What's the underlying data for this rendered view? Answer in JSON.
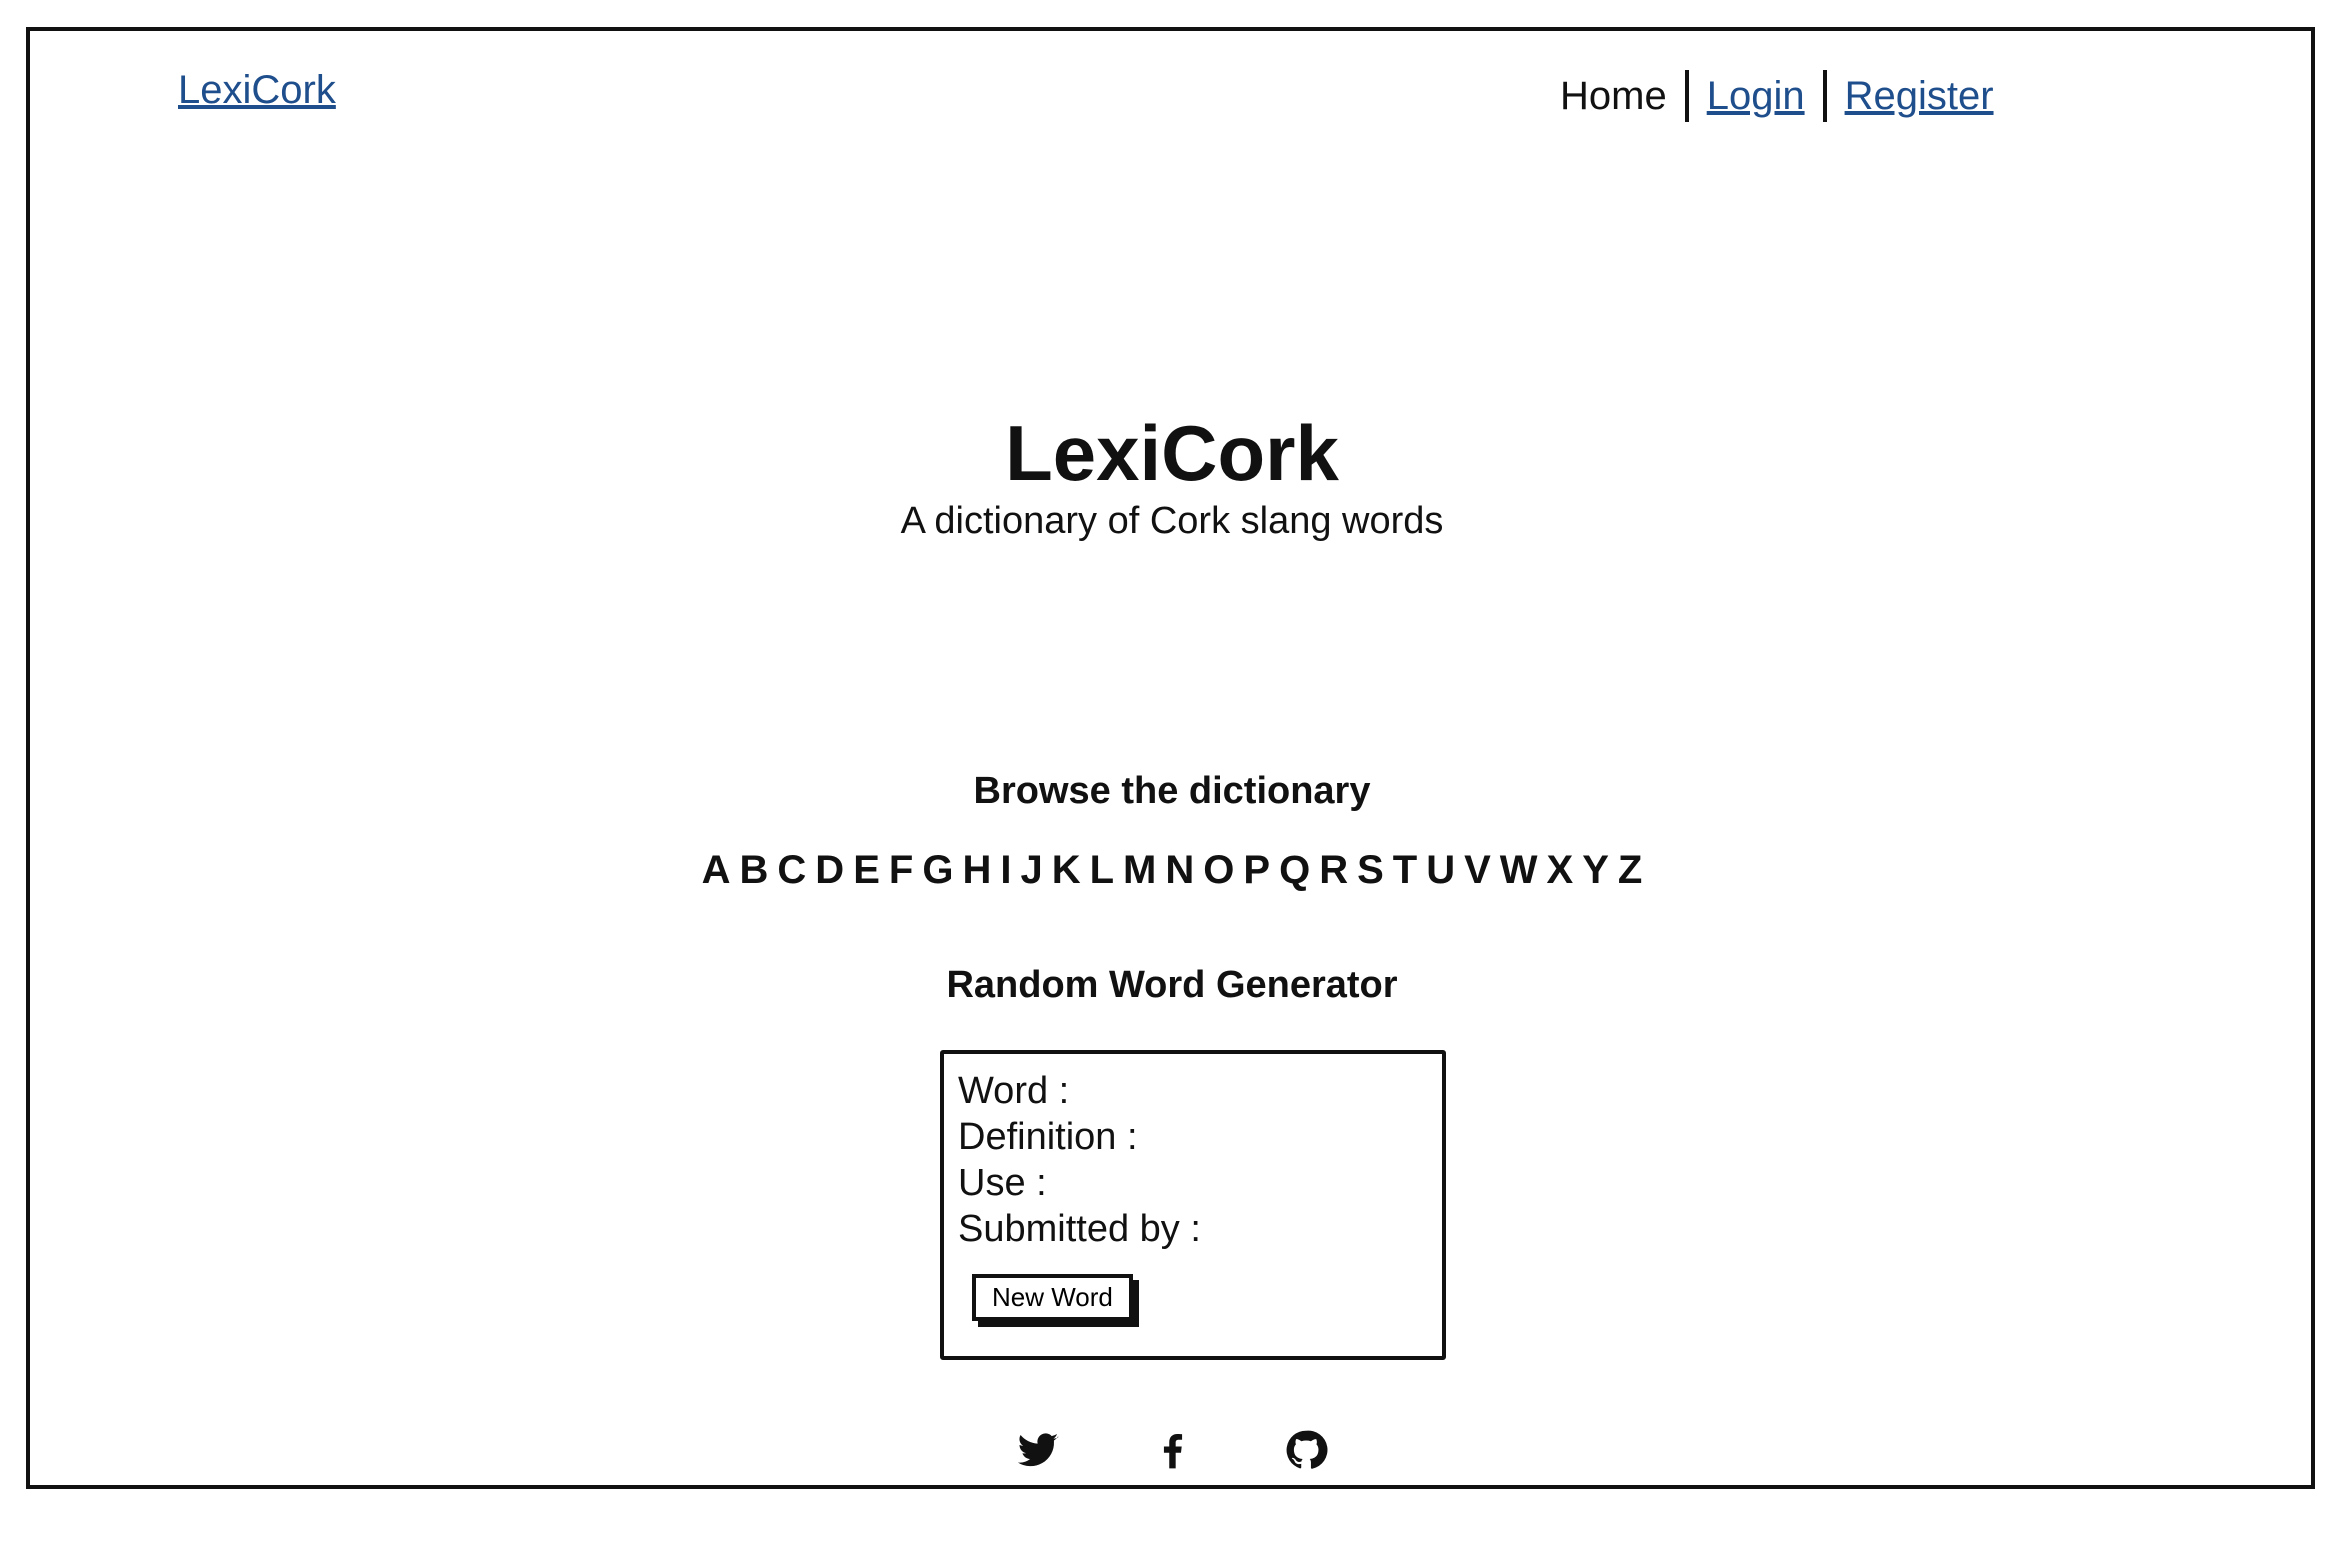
{
  "header": {
    "brand": "LexiCork",
    "nav": {
      "home": "Home",
      "login": "Login",
      "register": "Register"
    }
  },
  "hero": {
    "title": "LexiCork",
    "subtitle": "A dictionary of Cork slang words"
  },
  "browse": {
    "heading": "Browse the dictionary",
    "letters": [
      "A",
      "B",
      "C",
      "D",
      "E",
      "F",
      "G",
      "H",
      "I",
      "J",
      "K",
      "L",
      "M",
      "N",
      "O",
      "P",
      "Q",
      "R",
      "S",
      "T",
      "U",
      "V",
      "W",
      "X",
      "Y",
      "Z"
    ]
  },
  "random": {
    "heading": "Random Word Generator",
    "word_label": "Word :",
    "definition_label": "Definition :",
    "use_label": "Use :",
    "submitted_label": "Submitted by :",
    "button_label": "New Word"
  },
  "footer": {
    "icons": [
      "twitter-icon",
      "facebook-icon",
      "github-icon"
    ]
  }
}
